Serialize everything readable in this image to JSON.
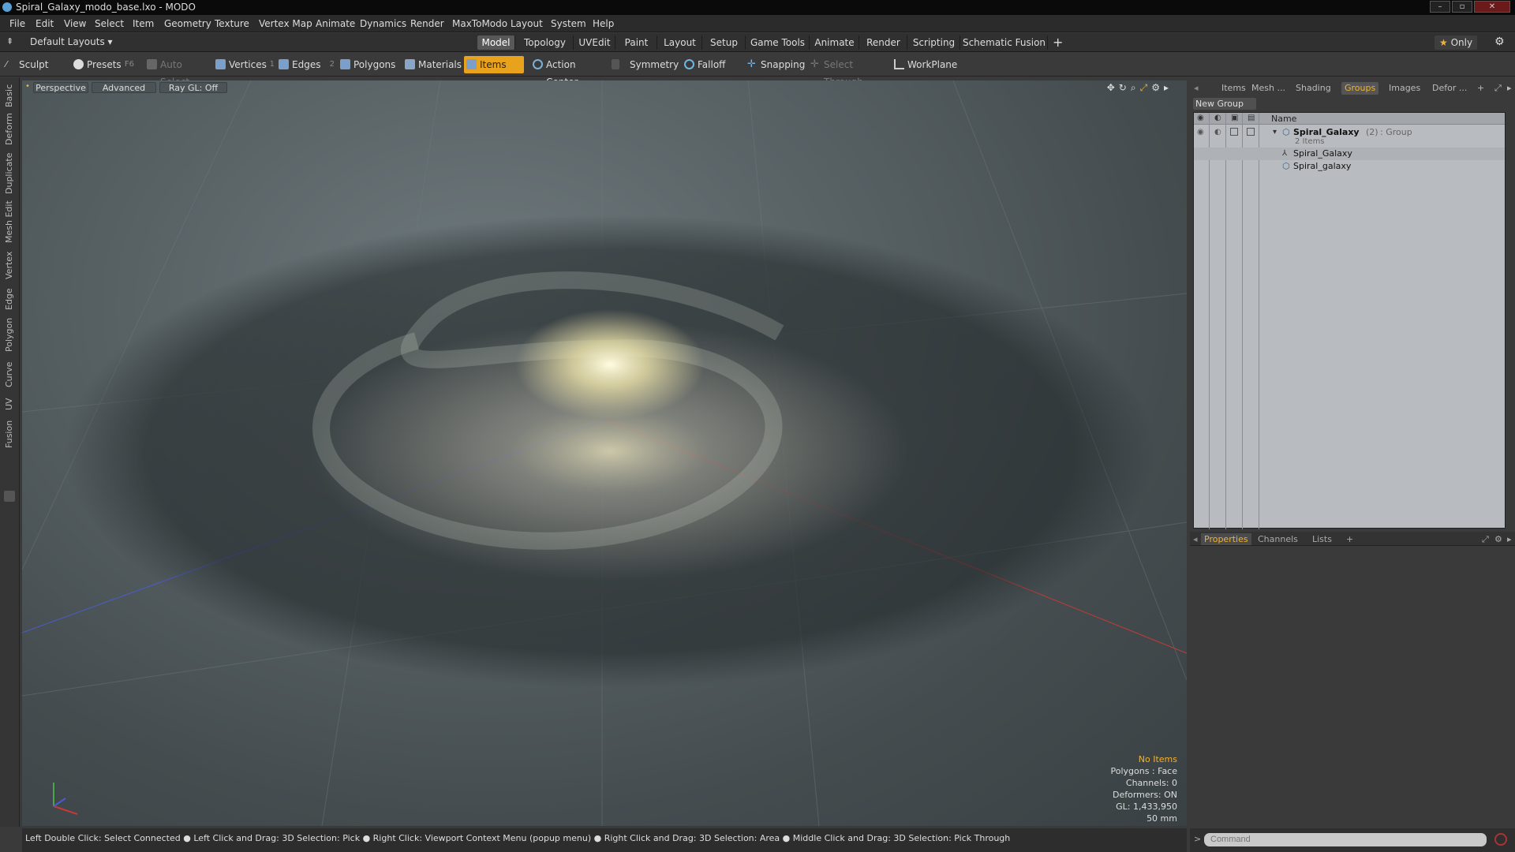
{
  "titlebar": {
    "title": "Spiral_Galaxy_modo_base.lxo - MODO"
  },
  "menu": [
    "File",
    "Edit",
    "View",
    "Select",
    "Item",
    "Geometry",
    "Texture",
    "Vertex Map",
    "Animate",
    "Dynamics",
    "Render",
    "MaxToModo",
    "Layout",
    "System",
    "Help"
  ],
  "layout_dropdown": "Default Layouts",
  "mode_tabs": [
    "Model",
    "Topology",
    "UVEdit",
    "Paint",
    "Layout",
    "Setup",
    "Game Tools",
    "Animate",
    "Render",
    "Scripting",
    "Schematic Fusion"
  ],
  "only_label": "Only",
  "toolbar": {
    "sculpt": "Sculpt",
    "presets": "Presets",
    "presets_key": "F6",
    "auto_select": "Auto Select",
    "vertices": "Vertices",
    "vertices_count": "1",
    "edges": "Edges",
    "edges_count": "2",
    "polygons": "Polygons",
    "materials": "Materials",
    "items": "Items",
    "action_center": "Action Center",
    "symmetry": "Symmetry",
    "falloff": "Falloff",
    "snapping": "Snapping",
    "select_through": "Select Through",
    "workplane": "WorkPlane"
  },
  "left_tabs": [
    "Basic",
    "Deform",
    "Duplicate",
    "Mesh Edit",
    "Vertex",
    "Edge",
    "Polygon",
    "Curve",
    "UV",
    "Fusion"
  ],
  "viewport": {
    "view": "Perspective",
    "advanced": "Advanced",
    "raygl": "Ray GL: Off",
    "stats": {
      "items": "No Items",
      "polygons": "Polygons : Face",
      "channels": "Channels: 0",
      "deformers": "Deformers: ON",
      "gl": "GL: 1,433,950",
      "scale": "50 mm"
    }
  },
  "statusbar": "Left Double Click: Select Connected ● Left Click and Drag: 3D Selection: Pick ● Right Click: Viewport Context Menu (popup menu) ● Right Click and Drag: 3D Selection: Area ● Middle Click and Drag: 3D Selection: Pick Through",
  "right_tabs": [
    "Items",
    "Mesh ...",
    "Shading",
    "Groups",
    "Images",
    "Defor ..."
  ],
  "new_group": "New Group",
  "tree": {
    "header": "Name",
    "group_name": "Spiral_Galaxy",
    "group_count": "(2)",
    "group_type": ": Group",
    "group_sub": "2 Items",
    "children": [
      "Spiral_Galaxy",
      "Spiral_galaxy"
    ]
  },
  "prop_tabs": [
    "Properties",
    "Channels",
    "Lists"
  ],
  "command_placeholder": "Command",
  "colors": {
    "accent": "#e8a21b",
    "highlight": "#f2b233"
  }
}
